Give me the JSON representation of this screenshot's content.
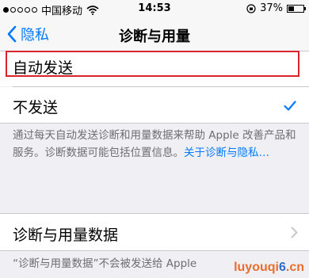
{
  "status_bar": {
    "carrier": "中国移动",
    "time": "14:53",
    "battery_percent": "37%",
    "battery_level": 0.37,
    "signal_bars_filled": 1,
    "signal_bars_total": 5
  },
  "nav": {
    "back_label": "隐私",
    "title": "诊断与用量"
  },
  "options": [
    {
      "label": "自动发送",
      "selected": false
    },
    {
      "label": "不发送",
      "selected": true
    }
  ],
  "footer": {
    "text": "通过每天自动发送诊断和用量数据来帮助 Apple 改善产品和服务。诊断数据可能包括位置信息。",
    "link": "关于诊断与隐私…"
  },
  "data_row": {
    "label": "诊断与用量数据"
  },
  "bottom_note": "“诊断与用量数据”不会被发送给 Apple",
  "watermark": {
    "orange_part": "luyouqi",
    "blue_part": "6",
    "tail": ".cn"
  },
  "colors": {
    "accent": "#007aff",
    "highlight_border": "#d8242c",
    "background": "#efeff4"
  }
}
